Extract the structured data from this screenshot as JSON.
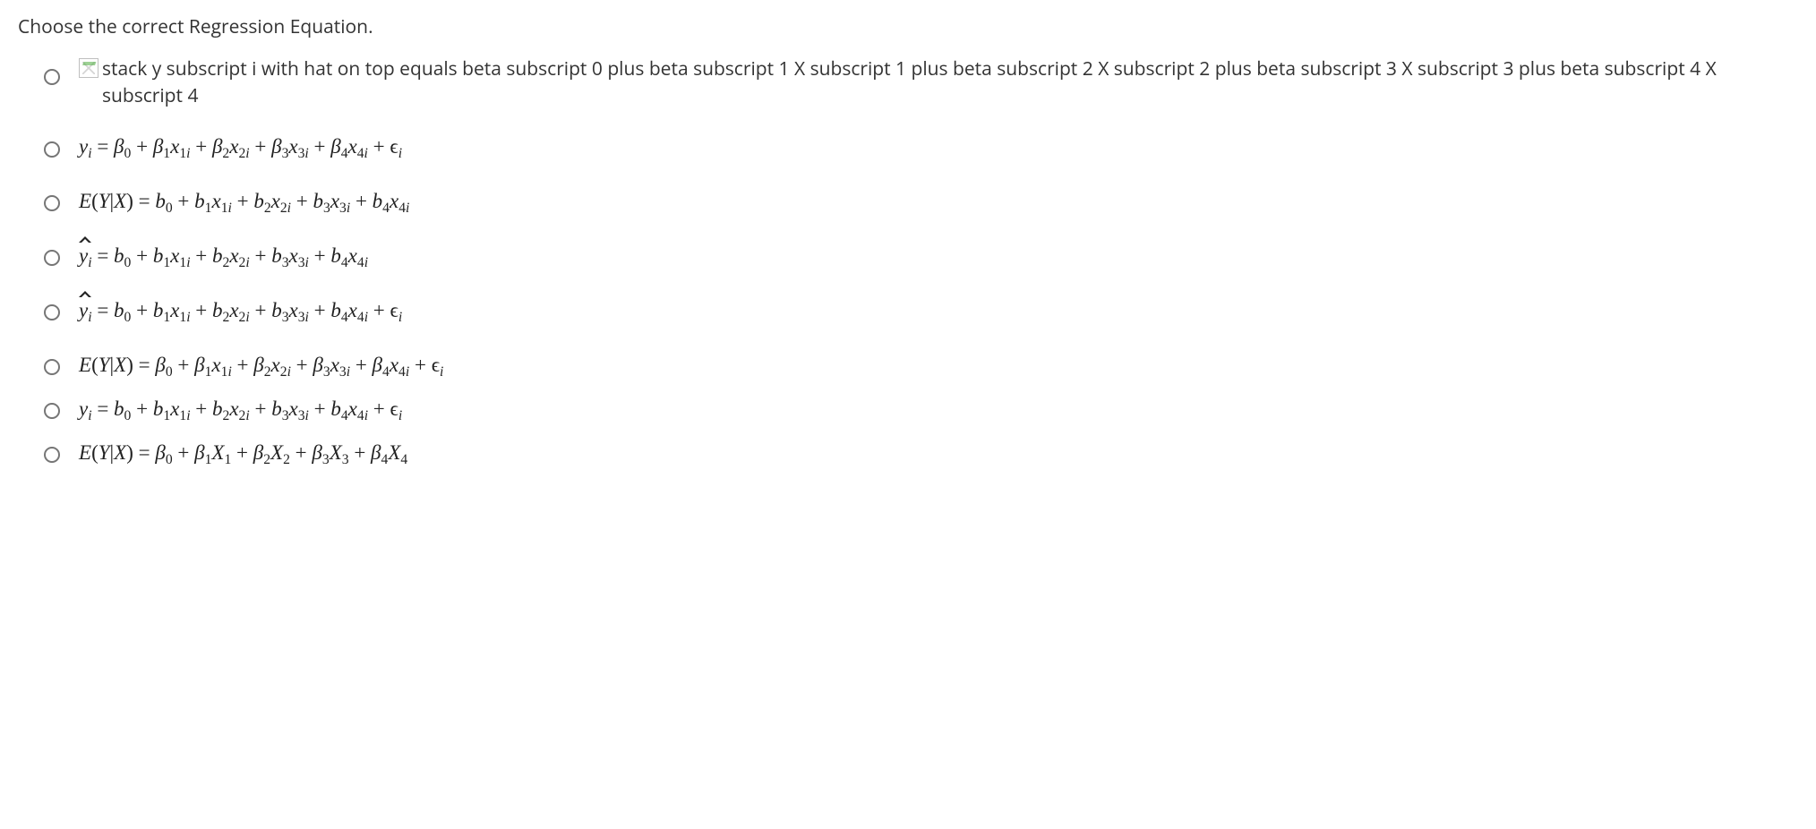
{
  "prompt": "Choose the correct Regression Equation.",
  "options": [
    {
      "id": "opt1",
      "type": "alt-text",
      "text": "stack y subscript i with hat on top equals beta subscript 0 plus beta subscript 1 X subscript 1 plus beta subscript 2 X subscript 2 plus beta subscript 3 X subscript 3 plus beta subscript 4 X subscript 4"
    },
    {
      "id": "opt2",
      "type": "math",
      "lhs": "y_i",
      "rhs_symbol": "beta",
      "subscripted_x": true,
      "epsilon": true
    },
    {
      "id": "opt3",
      "type": "math",
      "lhs": "E(Y|X)",
      "rhs_symbol": "b",
      "subscripted_x": true,
      "epsilon": false
    },
    {
      "id": "opt4",
      "type": "math",
      "lhs": "yhat_i",
      "rhs_symbol": "b",
      "subscripted_x": true,
      "epsilon": false
    },
    {
      "id": "opt5",
      "type": "math",
      "lhs": "yhat_i",
      "rhs_symbol": "b",
      "subscripted_x": true,
      "epsilon": true
    },
    {
      "id": "opt6",
      "type": "math",
      "lhs": "E(Y|X)",
      "rhs_symbol": "beta",
      "subscripted_x": true,
      "epsilon": true
    },
    {
      "id": "opt7",
      "type": "math",
      "lhs": "y_i",
      "rhs_symbol": "b",
      "subscripted_x": true,
      "epsilon": true
    },
    {
      "id": "opt8",
      "type": "math",
      "lhs": "E(Y|X)",
      "rhs_symbol": "beta",
      "subscripted_x": false,
      "epsilon": false
    }
  ]
}
